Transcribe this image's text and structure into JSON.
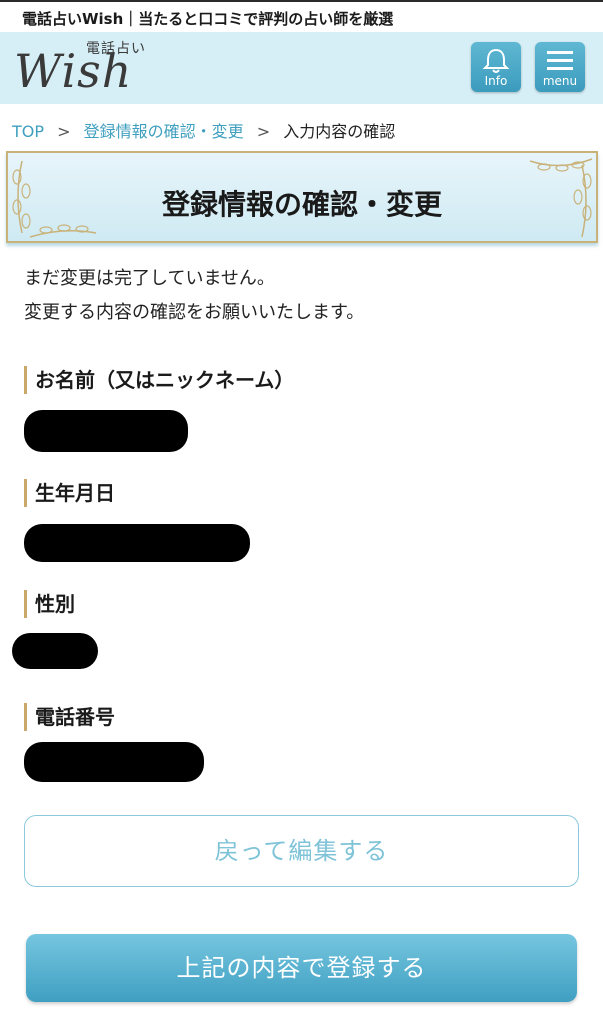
{
  "topbar": {
    "text": "電話占いWish｜当たると口コミで評判の占い師を厳選"
  },
  "header": {
    "logo_small": "電話占い",
    "logo_main": "Wish",
    "info_label": "Info",
    "menu_label": "menu",
    "accent": "#d6eef6",
    "button_color": "#4aa9c8"
  },
  "breadcrumb": {
    "items": [
      "TOP",
      "登録情報の確認・変更",
      "入力内容の確認"
    ],
    "separator": ">"
  },
  "page": {
    "title": "登録情報の確認・変更",
    "intro_line1": "まだ変更は完了していません。",
    "intro_line2": "変更する内容の確認をお願いいたします。"
  },
  "fields": [
    {
      "label": "お名前（又はニックネーム）"
    },
    {
      "label": "生年月日"
    },
    {
      "label": "性別"
    },
    {
      "label": "電話番号"
    }
  ],
  "buttons": {
    "back": "戻って編集する",
    "submit": "上記の内容で登録する"
  }
}
